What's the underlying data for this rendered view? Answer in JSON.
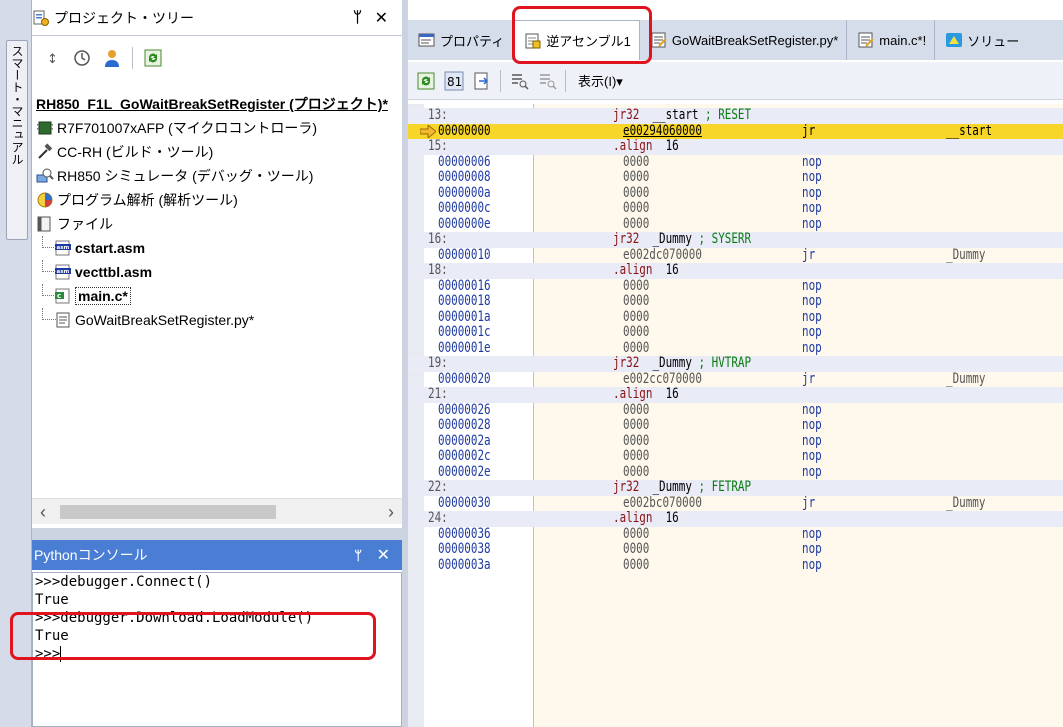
{
  "side_strip": {
    "label": "スマート・マニュアル"
  },
  "project_panel": {
    "title": "プロジェクト・ツリー",
    "pin": "ᛘ",
    "close": "✕",
    "tree": {
      "root": "RH850_F1L_GoWaitBreakSetRegister (プロジェクト)*",
      "items": [
        "R7F701007xAFP (マイクロコントローラ)",
        "CC-RH (ビルド・ツール)",
        "RH850 シミュレータ (デバッグ・ツール)",
        "プログラム解析 (解析ツール)",
        "ファイル"
      ],
      "files": [
        "cstart.asm",
        "vecttbl.asm",
        "main.c*",
        "GoWaitBreakSetRegister.py*"
      ]
    }
  },
  "python_console": {
    "title": "Pythonコンソール",
    "pin": "ᛘ",
    "close": "✕",
    "lines": [
      ">>>debugger.Connect()",
      "True",
      ">>>debugger.Download.LoadModule()",
      "True",
      ">>>"
    ]
  },
  "tabs": [
    {
      "label": "プロパティ"
    },
    {
      "label": "逆アセンブル1"
    },
    {
      "label": "GoWaitBreakSetRegister.py*"
    },
    {
      "label": "main.c*!"
    },
    {
      "label": "ソリュー"
    }
  ],
  "toolbar": {
    "display_menu": "表示(I)▾"
  },
  "disasm": [
    {
      "type": "src",
      "lbl": "13:",
      "kw": "jr32",
      "arg": "  __start",
      "cmt": " ; RESET"
    },
    {
      "type": "ins",
      "addr": "00000000",
      "code": "e00294060000",
      "mn": "jr",
      "op": "__start",
      "current": true
    },
    {
      "type": "src",
      "lbl": "15:",
      "kw": ".align",
      "arg": "  16",
      "cmt": ""
    },
    {
      "type": "ins",
      "addr": "00000006",
      "code": "0000",
      "mn": "nop",
      "op": ""
    },
    {
      "type": "ins",
      "addr": "00000008",
      "code": "0000",
      "mn": "nop",
      "op": ""
    },
    {
      "type": "ins",
      "addr": "0000000a",
      "code": "0000",
      "mn": "nop",
      "op": ""
    },
    {
      "type": "ins",
      "addr": "0000000c",
      "code": "0000",
      "mn": "nop",
      "op": ""
    },
    {
      "type": "ins",
      "addr": "0000000e",
      "code": "0000",
      "mn": "nop",
      "op": ""
    },
    {
      "type": "src",
      "lbl": "16:",
      "kw": "jr32",
      "arg": "  _Dummy",
      "cmt": " ; SYSERR"
    },
    {
      "type": "ins",
      "addr": "00000010",
      "code": "e002dc070000",
      "mn": "jr",
      "op": "_Dummy"
    },
    {
      "type": "src",
      "lbl": "18:",
      "kw": ".align",
      "arg": "  16",
      "cmt": ""
    },
    {
      "type": "ins",
      "addr": "00000016",
      "code": "0000",
      "mn": "nop",
      "op": ""
    },
    {
      "type": "ins",
      "addr": "00000018",
      "code": "0000",
      "mn": "nop",
      "op": ""
    },
    {
      "type": "ins",
      "addr": "0000001a",
      "code": "0000",
      "mn": "nop",
      "op": ""
    },
    {
      "type": "ins",
      "addr": "0000001c",
      "code": "0000",
      "mn": "nop",
      "op": ""
    },
    {
      "type": "ins",
      "addr": "0000001e",
      "code": "0000",
      "mn": "nop",
      "op": ""
    },
    {
      "type": "src",
      "lbl": "19:",
      "kw": "jr32",
      "arg": "  _Dummy",
      "cmt": " ; HVTRAP"
    },
    {
      "type": "ins",
      "addr": "00000020",
      "code": "e002cc070000",
      "mn": "jr",
      "op": "_Dummy"
    },
    {
      "type": "src",
      "lbl": "21:",
      "kw": ".align",
      "arg": "  16",
      "cmt": ""
    },
    {
      "type": "ins",
      "addr": "00000026",
      "code": "0000",
      "mn": "nop",
      "op": ""
    },
    {
      "type": "ins",
      "addr": "00000028",
      "code": "0000",
      "mn": "nop",
      "op": ""
    },
    {
      "type": "ins",
      "addr": "0000002a",
      "code": "0000",
      "mn": "nop",
      "op": ""
    },
    {
      "type": "ins",
      "addr": "0000002c",
      "code": "0000",
      "mn": "nop",
      "op": ""
    },
    {
      "type": "ins",
      "addr": "0000002e",
      "code": "0000",
      "mn": "nop",
      "op": ""
    },
    {
      "type": "src",
      "lbl": "22:",
      "kw": "jr32",
      "arg": "  _Dummy",
      "cmt": " ; FETRAP"
    },
    {
      "type": "ins",
      "addr": "00000030",
      "code": "e002bc070000",
      "mn": "jr",
      "op": "_Dummy"
    },
    {
      "type": "src",
      "lbl": "24:",
      "kw": ".align",
      "arg": "  16",
      "cmt": ""
    },
    {
      "type": "ins",
      "addr": "00000036",
      "code": "0000",
      "mn": "nop",
      "op": ""
    },
    {
      "type": "ins",
      "addr": "00000038",
      "code": "0000",
      "mn": "nop",
      "op": ""
    },
    {
      "type": "ins",
      "addr": "0000003a",
      "code": "0000",
      "mn": "nop",
      "op": ""
    }
  ],
  "colors": {
    "highlight": "#e0141e",
    "current_line": "#f7d629",
    "console_title": "#4a7ed4"
  }
}
